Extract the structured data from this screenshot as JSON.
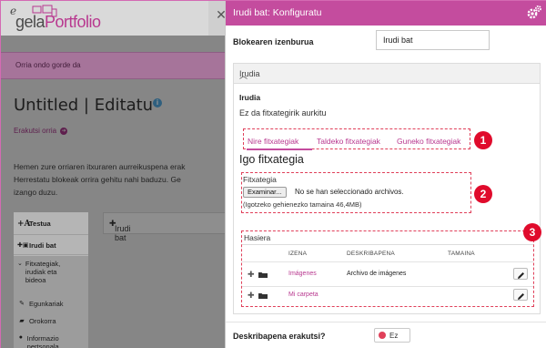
{
  "background": {
    "logo": {
      "e": "e",
      "gela": "gela",
      "portfolio": "Portfolio"
    },
    "saved_message": "Orria ondo gorde da",
    "page_title": "Untitled | Editatu",
    "view_link": "Erakutsi orria",
    "description_lines": [
      "Hemen zure orriaren itxuraren aurreikuspena erak",
      "Herrestatu blokeak orrira gehitu nahi baduzu. Ge",
      "izango duzu."
    ],
    "sidebar": [
      {
        "label": "Testua",
        "icon": "text-icon"
      },
      {
        "label": "Irudi bat",
        "icon": "image-icon"
      },
      {
        "label": "Fitxategiak, irudiak eta bideoa",
        "icon": "files-icon"
      },
      {
        "label": "Egunkariak",
        "icon": "pencil-icon"
      },
      {
        "label": "Orokorra",
        "icon": "briefcase-icon"
      },
      {
        "label": "Informazio pertsonala",
        "icon": "user-icon"
      }
    ],
    "block_label": "Irudi bat"
  },
  "panel": {
    "title": "Irudi bat: Konfiguratu",
    "block_title_label": "Blokearen izenburua",
    "block_title_value": "Irudi bat",
    "section_title": "Irudia",
    "image_label": "Irudia",
    "no_files": "Ez da fitxategirik aurkitu",
    "tabs": [
      "Nire fitxategiak",
      "Taldeko fitxategiak",
      "Guneko fitxategiak"
    ],
    "upload_title": "Igo fitxategia",
    "file_label": "Fitxategia",
    "browse_button": "Examinar...",
    "file_status": "No se han seleccionado archivos.",
    "max_size": "(Igotzeko gehienezko tamaina 46,4MB)",
    "home_label": "Hasiera",
    "columns": [
      "IZENA",
      "DESKRIBAPENA",
      "TAMAINA"
    ],
    "rows": [
      {
        "name": "Imágenes",
        "description": "Archivo de imágenes"
      },
      {
        "name": "Mi carpeta",
        "description": ""
      }
    ],
    "show_description_label": "Deskribapena erakutsi?",
    "toggle_value": "Ez",
    "badges": [
      "1",
      "2",
      "3"
    ],
    "colors": {
      "accent": "#c44c9e",
      "annotation": "#e00b2c"
    }
  }
}
